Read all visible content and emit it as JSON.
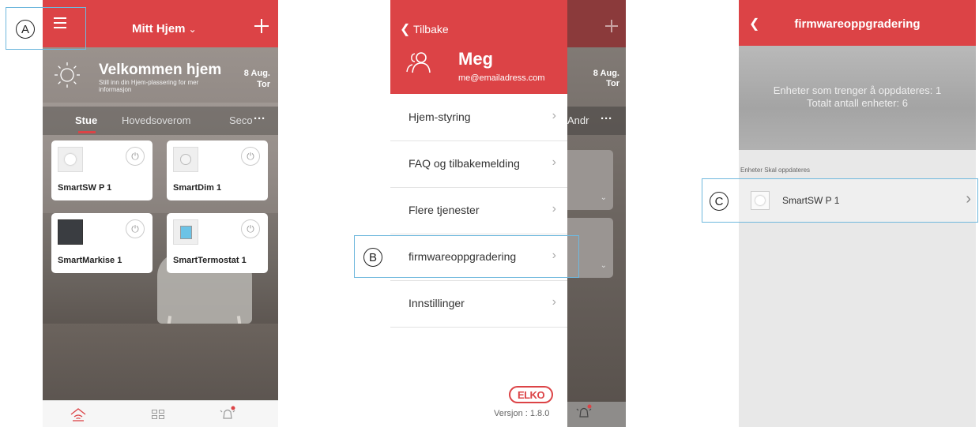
{
  "colors": {
    "accent": "#dc4346",
    "callout": "#6fb8dd"
  },
  "callouts": {
    "a": "A",
    "b": "B",
    "c": "C"
  },
  "screen1": {
    "home_name": "Mitt Hjem",
    "welcome_title": "Velkommen hjem",
    "welcome_sub": "Still inn din Hjem-plassering for mer informasjon",
    "date": "8 Aug.",
    "day": "Tor",
    "rooms": [
      "Stue",
      "Hovedsoverom",
      "Seco"
    ],
    "more": "···",
    "devices": [
      "SmartSW P 1",
      "SmartDim 1",
      "SmartMarkise 1",
      "SmartTermostat 1"
    ]
  },
  "screen2": {
    "back_label": "Tilbake",
    "user_name": "Meg",
    "email": "me@emailadress.com",
    "menu": [
      "Hjem-styring",
      "FAQ og tilbakemelding",
      "Flere tjenester",
      "firmwareoppgradering",
      "Innstillinger"
    ],
    "date": "8 Aug.",
    "day": "Tor",
    "tab_fragment": "Andr",
    "more": "···",
    "brand": "ELKO",
    "version": "Versjon : 1.8.0"
  },
  "screen3": {
    "title": "firmwareoppgradering",
    "status_line1": "Enheter som trenger å oppdateres: 1",
    "status_line2": "Totalt antall enheter: 6",
    "section_label": "Enheter Skal oppdateres",
    "device": "SmartSW P 1"
  }
}
